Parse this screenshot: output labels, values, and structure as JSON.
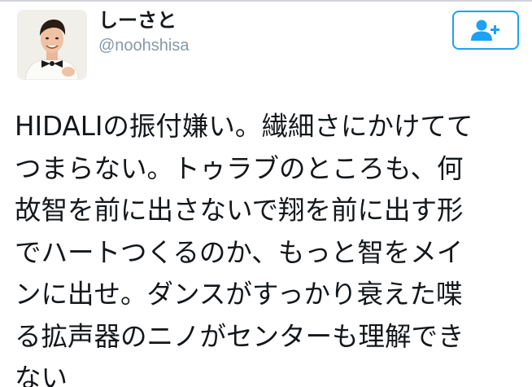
{
  "user": {
    "display_name": "しーさと",
    "username": "@noohshisa"
  },
  "follow_button": {
    "icon": "add-user-icon"
  },
  "tweet": {
    "lines": [
      "HIDALIの振付嫌い。繊細さにかけてて",
      "つまらない。トゥラブのところも、何",
      "故智を前に出さないで翔を前に出す形",
      "でハートつくるのか、もっと智をメイ",
      "ンに出せ。ダンスがすっかり衰えた喋",
      "る拡声器のニノがセンターも理解でき",
      "ない"
    ]
  },
  "colors": {
    "accent": "#1da1f2",
    "text": "#14171a",
    "muted": "#8899a6"
  }
}
